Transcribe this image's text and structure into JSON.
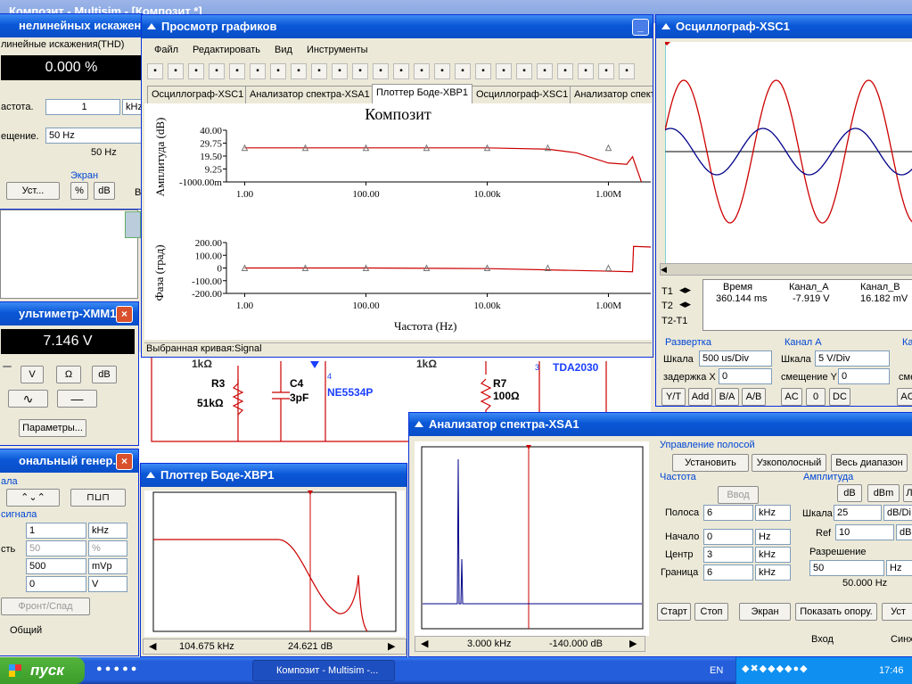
{
  "taskbar": {
    "start": "пуск",
    "task": "Композит - Multisim -...",
    "lang": "EN",
    "clock": "17:46"
  },
  "thd": {
    "title": "нелинейных искажени-...",
    "sub": "линейные искажения(THD)",
    "value": "0.000 %",
    "freq_label": "астота.",
    "freq_value": "1",
    "freq_unit": "kHz",
    "bias_label": "ещение.",
    "bias_value": "50 Hz",
    "bias_value2": "50 Hz",
    "screen_label": "Экран",
    "b_set": "Уст...",
    "b_pct": "%",
    "b_db": "dB",
    "b_frag": "В"
  },
  "mm": {
    "title": "ультиметр-XMM1",
    "value": "7.146 V",
    "b_v": "V",
    "b_ohm": "Ω",
    "b_db": "dB",
    "b_params": "Параметры..."
  },
  "fg": {
    "title": "ональный генер...",
    "group1": "ала",
    "group2": "сигнала",
    "freq": "1",
    "freq_unit": "kHz",
    "duty_label": "сть",
    "duty": "50",
    "duty_unit": "%",
    "amp": "500",
    "amp_unit": "mVp",
    "offset": "0",
    "offset_unit": "V",
    "b_edge": "Фронт/Спад",
    "common": "Общий"
  },
  "grapher": {
    "title": "Просмотр графиков",
    "menu": [
      "Файл",
      "Редактировать",
      "Вид",
      "Инструменты"
    ],
    "tabs": [
      "Осциллограф-XSC1",
      "Анализатор спектра-XSA1",
      "Плоттер Боде-XBP1",
      "Осциллограф-XSC1",
      "Анализатор спект"
    ],
    "plot_title": "Композит",
    "amp_ylabel": "Амплитуда (dB)",
    "phase_ylabel": "Фаза (град)",
    "xlabel": "Частота (Hz)",
    "amp_ticks": [
      "40.00",
      "29.75",
      "19.50",
      "9.25",
      "-1000.00m"
    ],
    "phase_ticks": [
      "200.00",
      "100.00",
      "0",
      "-100.00",
      "-200.00"
    ],
    "x_ticks": [
      "1.00",
      "100.00",
      "10.00k",
      "1.00M"
    ],
    "status": "Выбранная кривая:Signal"
  },
  "schematic": {
    "r3": "R3",
    "r3v": "51kΩ",
    "c4": "C4",
    "c4v": "3pF",
    "op1": "NE5534P",
    "r7": "R7",
    "r7v": "100Ω",
    "amp2": "TDA2030",
    "k1": "1kΩ",
    "k2": "1kΩ",
    "pin3": "3",
    "pin4": "4"
  },
  "scope": {
    "title": "Осциллограф-XSC1",
    "h_time": "Время",
    "h_a": "Канал_A",
    "h_b": "Канал_B",
    "t1": "T1",
    "t2": "T2",
    "t21": "T2-T1",
    "time_val": "360.144 ms",
    "a_val": "-7.919 V",
    "b_val": "16.182 mV",
    "sweep": "Развертка",
    "chA": "Канал A",
    "chB": "Ка",
    "scale_label": "Шкала",
    "scale_val": "500 us/Div",
    "delay_label": "задержка X",
    "delay_val": "0",
    "a_scale_label": "Шкала",
    "a_scale": "5  V/Div",
    "a_off_label": "смещение Y",
    "a_off": "0",
    "b_off_frag": "сме",
    "b_yt": "Y/T",
    "b_add": "Add",
    "b_ba": "B/A",
    "b_ab": "A/B",
    "b_ac": "AC",
    "b_0": "0",
    "b_dc": "DC",
    "b_ac2": "AC"
  },
  "bode": {
    "title": "Плоттер Боде-XBP1",
    "freq": "104.675 kHz",
    "val": "24.621 dB"
  },
  "sa": {
    "title": "Анализатор спектра-XSA1",
    "freq": "3.000 kHz",
    "val": "-140.000  dB",
    "band_ctrl": "Управление полосой",
    "b_set": "Установить",
    "b_narrow": "Узкополосный",
    "b_full": "Весь диапазон",
    "freq_grp": "Частота",
    "b_enter": "Ввод",
    "span_label": "Полоса",
    "span": "6",
    "span_unit": "kHz",
    "start_label": "Начало",
    "start": "0",
    "start_unit": "Hz",
    "center_label": "Центр",
    "center": "3",
    "center_unit": "kHz",
    "end_label": "Граница",
    "end": "6",
    "end_unit": "kHz",
    "amp_grp": "Амплитуда",
    "b_db": "dB",
    "b_dbm": "dBm",
    "b_lin": "Л",
    "scale_label": "Шкала",
    "scale": "25",
    "scale_unit": "dB/Di",
    "ref_label": "Ref",
    "ref": "10",
    "ref_unit": "dB",
    "res_label": "Разрешение",
    "res": "50",
    "res_unit": "Hz",
    "res_val": "50.000  Hz",
    "b_start": "Старт",
    "b_stop": "Стоп",
    "b_screen": "Экран",
    "b_showref": "Показать опору.",
    "b_ust": "Уст",
    "in_label": "Вход",
    "sync_label": "Синх"
  },
  "background_title": "Композит - Multisim - [Композит *]",
  "chart_data": {
    "type": "line",
    "title": "Композит",
    "xlabel": "Частота (Hz)",
    "x_scale": "log",
    "x_ticks": [
      "1.00",
      "100.00",
      "10.00k",
      "1.00M"
    ],
    "series": [
      {
        "name": "Амплитуда (dB)",
        "x": [
          1,
          10,
          100,
          1000,
          10000,
          100000,
          300000,
          1000000,
          2000000,
          2500000,
          3500000
        ],
        "y": [
          26,
          26,
          26,
          26,
          26,
          25,
          22,
          14,
          13,
          19,
          -1
        ]
      },
      {
        "name": "Фаза (град)",
        "x": [
          1,
          100,
          10000,
          100000,
          1000000,
          2500000,
          2600000,
          5000000
        ],
        "y": [
          0,
          0,
          -5,
          -15,
          -25,
          -30,
          170,
          165
        ]
      }
    ]
  }
}
